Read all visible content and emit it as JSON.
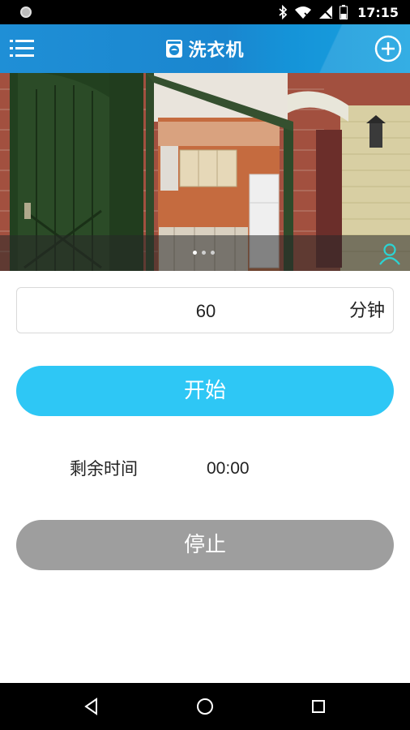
{
  "status_bar": {
    "time": "17:15",
    "icons": [
      "circle-icon",
      "bluetooth-icon",
      "wifi-icon",
      "no-signal-icon",
      "battery-icon"
    ]
  },
  "app_bar": {
    "title": "洗衣机",
    "title_icon": "washing-machine-icon",
    "menu_icon": "menu-icon",
    "add_icon": "add-circle-icon",
    "background": "#1a8ad2"
  },
  "banner": {
    "slide_count": 3,
    "active_slide": 1,
    "user_icon": "user-icon",
    "user_icon_color": "#2bd4d4"
  },
  "timer": {
    "duration_value": "60",
    "duration_unit": "分钟",
    "start_label": "开始",
    "remaining_label": "剩余时间",
    "remaining_value": "00:00",
    "stop_label": "停止"
  },
  "colors": {
    "start_button": "#2ec7f5",
    "stop_button": "#9e9e9e"
  },
  "nav_bar": {
    "buttons": [
      "back-icon",
      "home-icon",
      "recents-icon"
    ]
  }
}
